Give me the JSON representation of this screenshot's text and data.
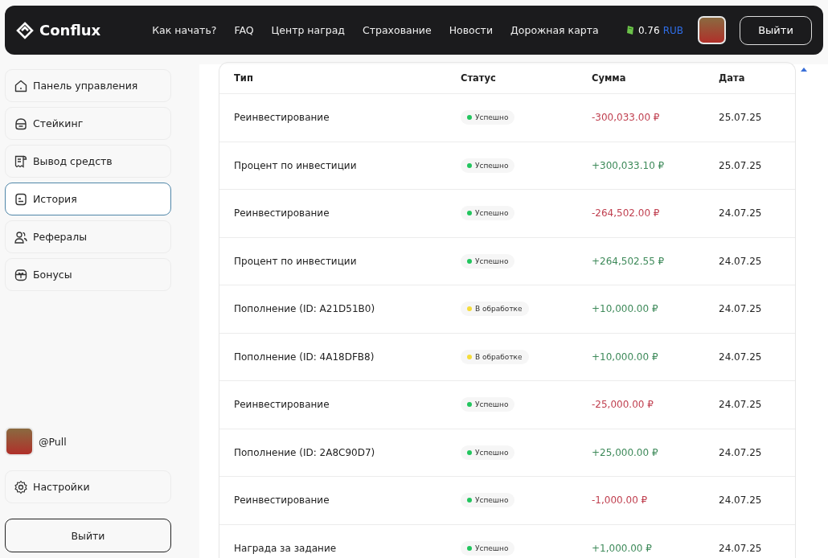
{
  "header": {
    "logo": "Conflux",
    "nav": [
      "Как начать?",
      "FAQ",
      "Центр наград",
      "Страхование",
      "Новости",
      "Дорожная карта"
    ],
    "balance": {
      "amount": "0.76",
      "currency": "RUB"
    },
    "logout": "Выйти"
  },
  "sidebar": {
    "items": [
      {
        "label": "Панель управления",
        "selected": false
      },
      {
        "label": "Стейкинг",
        "selected": false
      },
      {
        "label": "Вывод средств",
        "selected": false
      },
      {
        "label": "История",
        "selected": true
      },
      {
        "label": "Рефералы",
        "selected": false
      },
      {
        "label": "Бонусы",
        "selected": false
      }
    ],
    "user": "@Pull",
    "settings": "Настройки",
    "logout": "Выйти"
  },
  "table": {
    "columns": [
      "Тип",
      "Статус",
      "Сумма",
      "Дата"
    ],
    "rows": [
      {
        "type": "Реинвестирование",
        "status": {
          "label": "Успешно",
          "color": "#22c55e"
        },
        "kind": "debit",
        "amount": "-300,033.00 ₽",
        "date": "25.07.25"
      },
      {
        "type": "Процент по инвестиции",
        "status": {
          "label": "Успешно",
          "color": "#22c55e"
        },
        "kind": "credit",
        "amount": "+300,033.10 ₽",
        "date": "25.07.25"
      },
      {
        "type": "Реинвестирование",
        "status": {
          "label": "Успешно",
          "color": "#22c55e"
        },
        "kind": "debit",
        "amount": "-264,502.00 ₽",
        "date": "24.07.25"
      },
      {
        "type": "Процент по инвестиции",
        "status": {
          "label": "Успешно",
          "color": "#22c55e"
        },
        "kind": "credit",
        "amount": "+264,502.55 ₽",
        "date": "24.07.25"
      },
      {
        "type": "Пополнение (ID: A21D51B0)",
        "status": {
          "label": "В обработке",
          "color": "#f5dc3a"
        },
        "kind": "credit",
        "amount": "+10,000.00 ₽",
        "date": "24.07.25"
      },
      {
        "type": "Пополнение (ID: 4A18DFB8)",
        "status": {
          "label": "В обработке",
          "color": "#f5dc3a"
        },
        "kind": "credit",
        "amount": "+10,000.00 ₽",
        "date": "24.07.25"
      },
      {
        "type": "Реинвестирование",
        "status": {
          "label": "Успешно",
          "color": "#22c55e"
        },
        "kind": "debit",
        "amount": "-25,000.00 ₽",
        "date": "24.07.25"
      },
      {
        "type": "Пополнение (ID: 2A8C90D7)",
        "status": {
          "label": "Успешно",
          "color": "#22c55e"
        },
        "kind": "credit",
        "amount": "+25,000.00 ₽",
        "date": "24.07.25"
      },
      {
        "type": "Реинвестирование",
        "status": {
          "label": "Успешно",
          "color": "#22c55e"
        },
        "kind": "debit",
        "amount": "-1,000.00 ₽",
        "date": "24.07.25"
      },
      {
        "type": "Награда за задание",
        "status": {
          "label": "Успешно",
          "color": "#22c55e"
        },
        "kind": "credit",
        "amount": "+1,000.00 ₽",
        "date": "24.07.25"
      }
    ]
  }
}
